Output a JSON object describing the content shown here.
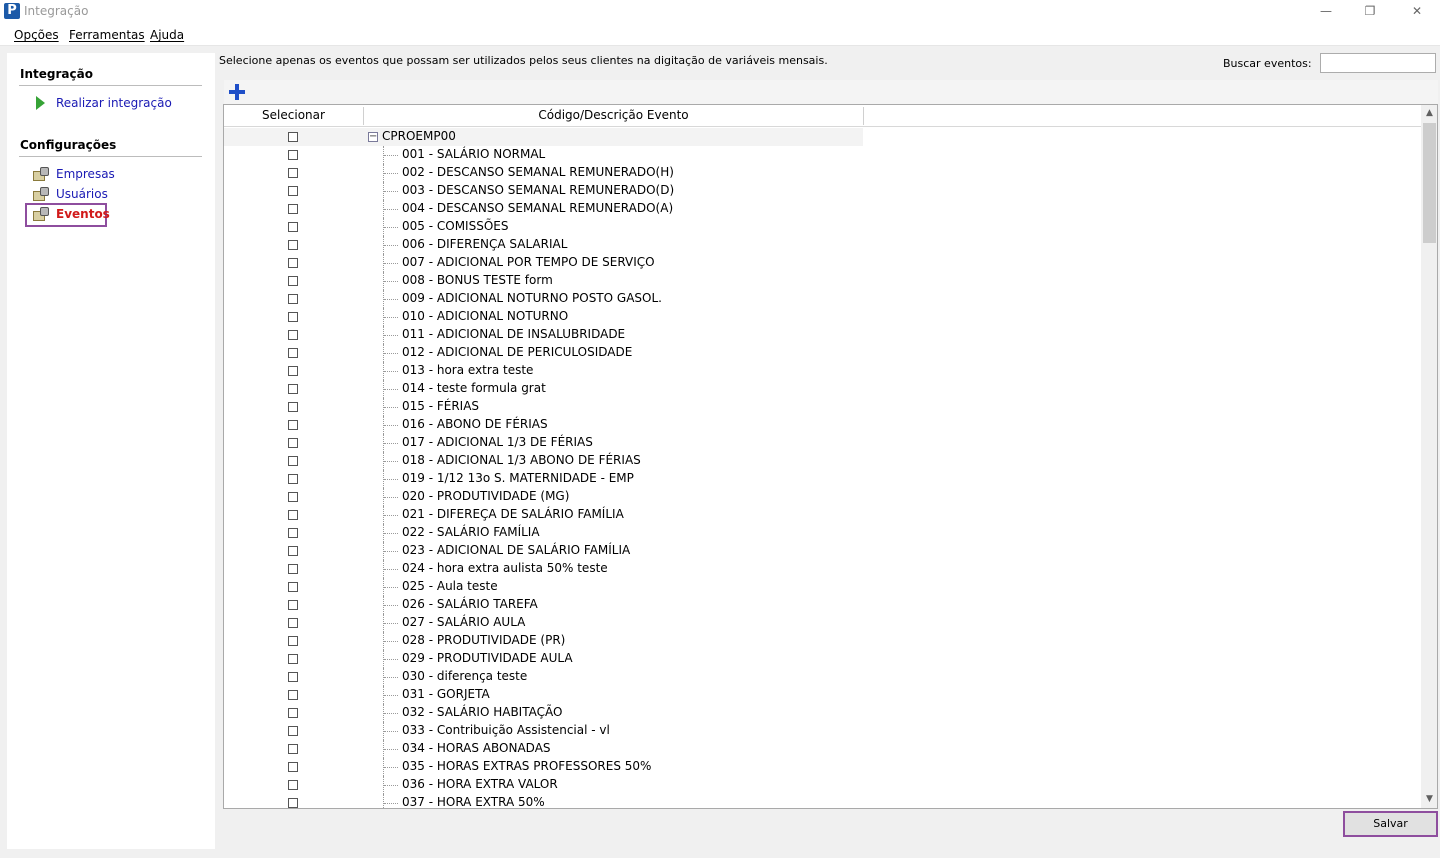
{
  "window": {
    "title": "Integração",
    "icon": "P",
    "controls": {
      "minimize": "—",
      "restore": "❐",
      "close": "✕"
    }
  },
  "menu": [
    "Opções",
    "Ferramentas",
    "Ajuda"
  ],
  "sidebar": {
    "integracao_title": "Integração",
    "realizar_label": "Realizar integração",
    "config_title": "Configurações",
    "items": [
      "Empresas",
      "Usuários",
      "Eventos"
    ]
  },
  "main": {
    "instruction": "Selecione apenas os eventos que possam ser utilizados pelos seus clientes na digitação de variáveis mensais.",
    "search_label": "Buscar eventos:",
    "search_value": "",
    "columns": [
      "Selecionar",
      "Código/Descrição Evento"
    ],
    "root_label": "CPROEMP00",
    "events": [
      "001 - SALÁRIO NORMAL",
      "002 - DESCANSO SEMANAL REMUNERADO(H)",
      "003 - DESCANSO SEMANAL REMUNERADO(D)",
      "004 - DESCANSO SEMANAL REMUNERADO(A)",
      "005 - COMISSÕES",
      "006 - DIFERENÇA SALARIAL",
      "007 - ADICIONAL POR TEMPO DE SERVIÇO",
      "008 - BONUS TESTE form",
      "009 - ADICIONAL NOTURNO POSTO GASOL.",
      "010 - ADICIONAL NOTURNO",
      "011 - ADICIONAL DE INSALUBRIDADE",
      "012 - ADICIONAL DE PERICULOSIDADE",
      "013 - hora extra teste",
      "014 - teste formula grat",
      "015 - FÉRIAS",
      "016 - ABONO DE FÉRIAS",
      "017 - ADICIONAL 1/3 DE FÉRIAS",
      "018 - ADICIONAL 1/3 ABONO DE FÉRIAS",
      "019 - 1/12 13o S. MATERNIDADE - EMP",
      "020 - PRODUTIVIDADE (MG)",
      "021 - DIFEREÇA DE SALÁRIO FAMÍLIA",
      "022 - SALÁRIO FAMÍLIA",
      "023 - ADICIONAL DE SALÁRIO FAMÍLIA",
      "024 - hora extra aulista 50% teste",
      "025 - Aula teste",
      "026 - SALÁRIO TAREFA",
      "027 - SALÁRIO AULA",
      "028 - PRODUTIVIDADE (PR)",
      "029 - PRODUTIVIDADE AULA",
      "030 - diferença teste",
      "031 - GORJETA",
      "032 - SALÁRIO HABITAÇÃO",
      "033 - Contribuição Assistencial - vl",
      "034 - HORAS ABONADAS",
      "035 - HORAS EXTRAS PROFESSORES 50%",
      "036 - HORA EXTRA VALOR",
      "037 - HORA EXTRA 50%"
    ],
    "save_label": "Salvar"
  },
  "colors": {
    "link": "#1a1ab4",
    "active": "#d11a1a",
    "highlight_border": "#8e4e9e",
    "plus": "#1f4fc8"
  }
}
